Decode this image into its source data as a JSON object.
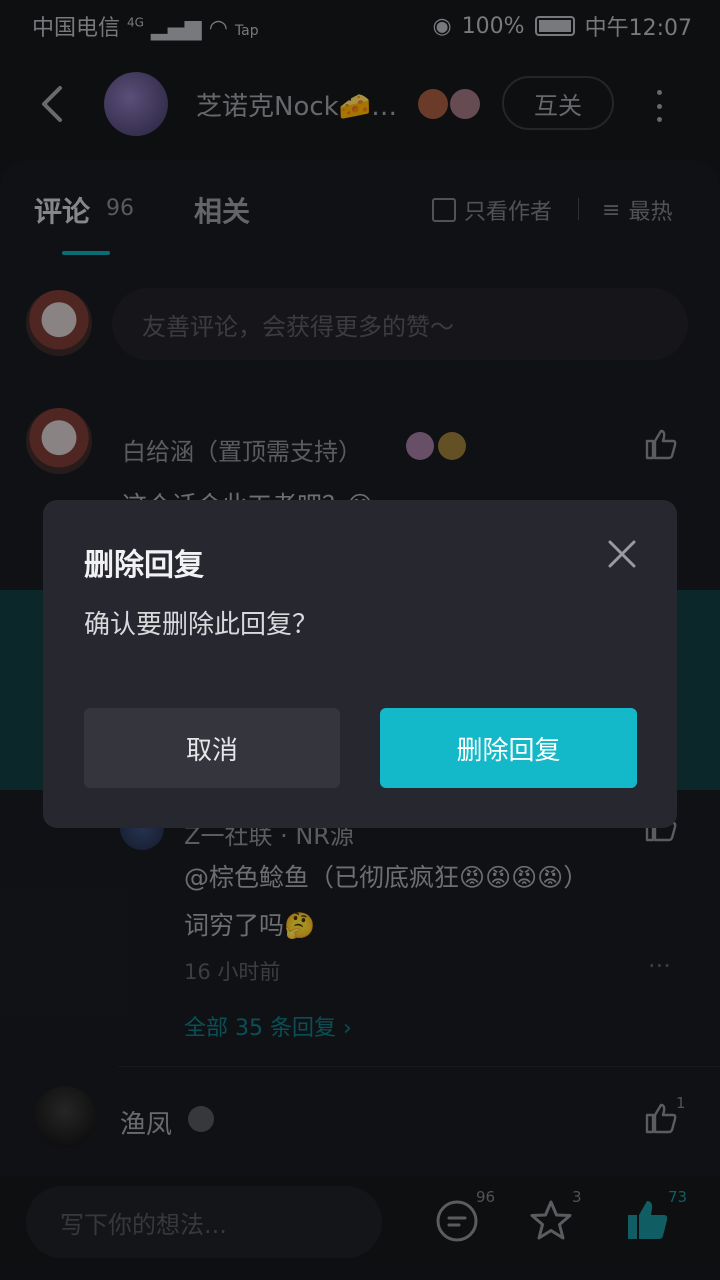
{
  "status_bar": {
    "carrier": "中国电信",
    "network": "4G",
    "tap": "Tap",
    "battery": "100%",
    "time": "中午12:07"
  },
  "header": {
    "username": "芝诺克Nock🧀…",
    "follow_label": "互关"
  },
  "tabs": {
    "comments_label": "评论",
    "comments_count": "96",
    "related_label": "相关",
    "author_only_label": "只看作者",
    "sort_label": "最热"
  },
  "composer": {
    "placeholder": "友善评论，会获得更多的赞～"
  },
  "comments": {
    "first_name": "白给涵（置顶需支持）",
    "first_text": "这个话会此工者吧？😅",
    "reply_name": "Z一社联 · NR源",
    "reply_mention": "@棕色鲶鱼（已彻底疯狂😡😡😡😡）",
    "reply_text": "词穷了吗🤔",
    "reply_time": "16 小时前",
    "all_replies": "全部 35 条回复 ›",
    "second_name": "渔凤",
    "second_likes": "1"
  },
  "bottom_bar": {
    "placeholder": "写下你的想法...",
    "comment_count": "96",
    "star_count": "3",
    "like_count": "73"
  },
  "dialog": {
    "title": "删除回复",
    "message": "确认要删除此回复？",
    "cancel_label": "取消",
    "confirm_label": "删除回复"
  },
  "colors": {
    "accent": "#13b9c8",
    "background": "#16171b",
    "dialog": "#26272f"
  }
}
